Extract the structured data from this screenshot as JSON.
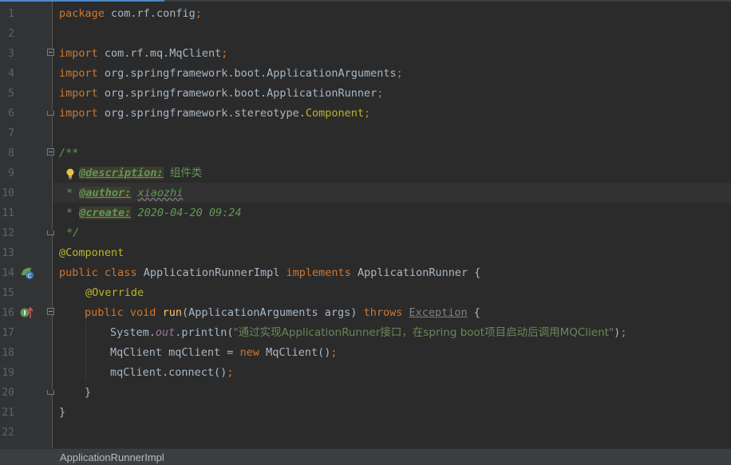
{
  "editor": {
    "line_numbers": [
      "1",
      "2",
      "3",
      "4",
      "5",
      "6",
      "7",
      "8",
      "9",
      "10",
      "11",
      "12",
      "13",
      "14",
      "15",
      "16",
      "17",
      "18",
      "19",
      "20",
      "21",
      "22"
    ],
    "package_kw": "package",
    "package_name": "com.rf.config",
    "semicolon": ";",
    "import_kw": "import",
    "imports": [
      {
        "path": "com.rf.mq.MqClient",
        "suffix": ""
      },
      {
        "path": "org.springframework.boot.ApplicationArguments",
        "suffix": ""
      },
      {
        "path": "org.springframework.boot.ApplicationRunner",
        "suffix": ""
      },
      {
        "path": "org.springframework.stereotype.",
        "suffix": "Component"
      }
    ],
    "doc_open": "/**",
    "doc_star": "*",
    "doc_close": "*/",
    "doc_description_tag": "@description:",
    "doc_description_value": "组件类",
    "doc_author_tag": "@author:",
    "doc_author_value": "xiaozhi",
    "doc_create_tag": "@create:",
    "doc_create_value": "2020-04-20 09:24",
    "annotation_component": "@Component",
    "public_kw": "public",
    "class_kw": "class",
    "class_name": "ApplicationRunnerImpl",
    "implements_kw": "implements",
    "interface_name": "ApplicationRunner",
    "open_brace": "{",
    "close_brace": "}",
    "annotation_override": "@Override",
    "void_kw": "void",
    "method_name": "run",
    "params": "(ApplicationArguments args)",
    "throws_kw": "throws",
    "exception_name": "Exception",
    "system": "System.",
    "out_field": "out",
    "println_open": ".println(",
    "println_string": "\"通过实现ApplicationRunner接口，在spring boot项目启动后调用MQClient\"",
    "println_close": ")",
    "mq_decl_start": "MqClient mqClient = ",
    "new_kw": "new",
    "mq_ctor": " MqClient()",
    "connect_call": "mqClient.connect()"
  },
  "status_bar": {
    "breadcrumb": "ApplicationRunnerImpl"
  },
  "colors": {
    "background": "#2b2b2b",
    "keyword": "#cc7832",
    "string": "#6a8759",
    "annotation": "#bbb529",
    "doc_comment": "#629755",
    "method_decl": "#ffc66d",
    "field": "#9876aa"
  },
  "icons": [
    "lightbulb-icon",
    "spring-bean-icon",
    "implement-method-icon",
    "fold-marker-icon"
  ]
}
